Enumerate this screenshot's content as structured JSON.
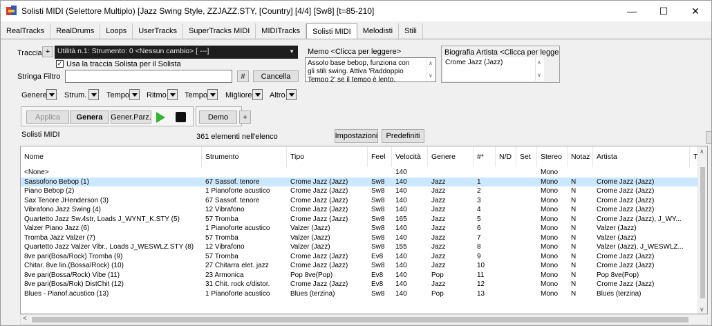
{
  "window": {
    "title": "Solisti MIDI  (Selettore Multiplo)  [Jazz Swing Style, ZZJAZZ.STY,  [Country] [4/4] [Sw8] [t=85-210]",
    "minimize": "—",
    "maximize": "☐",
    "close": "✕"
  },
  "tabs": [
    "RealTracks",
    "RealDrums",
    "Loops",
    "UserTracks",
    "SuperTracks MIDI",
    "MIDITracks",
    "Solisti MIDI",
    "Melodisti",
    "Stili"
  ],
  "active_tab": "Solisti MIDI",
  "track": {
    "label": "Traccia",
    "plus": "+",
    "value": "Utilità n.1: Strumento: 0 <Nessun cambio> [ ---]",
    "checkbox_label": "Usa la traccia Solista per il Solista",
    "checked": true
  },
  "filter": {
    "label": "Stringa Filtro",
    "value": "",
    "hash": "#",
    "cancel": "Cancella"
  },
  "memo": {
    "label": "Memo  <Clicca per leggere>",
    "text": "Assolo base bebop, funziona con gli stili swing. Attiva 'Raddoppio Tempo 2' se il tempo è lento."
  },
  "bio": {
    "label": "Biografia Artista  <Clicca per leggere>",
    "text": "Crome Jazz (Jazz)"
  },
  "filters": [
    "Genere",
    "Strum.",
    "Tempo",
    "Ritmo",
    "Tempo",
    "Migliore",
    "Altro"
  ],
  "actions": {
    "apply": "Applica",
    "generate": "Genera",
    "partial": "Gener.Parz.",
    "demo": "Demo",
    "plus": "+"
  },
  "list": {
    "title": "Solisti MIDI",
    "count": "361 elementi nell'elenco",
    "settings": "Impostazioni",
    "defaults": "Predefiniti"
  },
  "columns": [
    "Nome",
    "Strumento",
    "Tipo",
    "Feel",
    "Velocità",
    "Genere",
    "#*",
    "N/D",
    "Set",
    "Stereo",
    "Notaz",
    "Artista",
    "TS"
  ],
  "rows": [
    [
      "<None>",
      "",
      "",
      "",
      "140",
      "",
      "",
      "",
      "",
      "Mono",
      "",
      "",
      ""
    ],
    [
      "Sassofono Bebop  (1)",
      "67 Sassof. tenore",
      "Crome Jazz (Jazz)",
      "Sw8",
      "140",
      "Jazz",
      "1",
      "",
      "",
      "Mono",
      "N",
      "Crome Jazz (Jazz)",
      ""
    ],
    [
      "Piano Bebop  (2)",
      "1 Pianoforte acustico",
      "Crome Jazz (Jazz)",
      "Sw8",
      "140",
      "Jazz",
      "2",
      "",
      "",
      "Mono",
      "N",
      "Crome Jazz (Jazz)",
      ""
    ],
    [
      "Sax Tenore JHenderson  (3)",
      "67 Sassof. tenore",
      "Crome Jazz (Jazz)",
      "Sw8",
      "140",
      "Jazz",
      "3",
      "",
      "",
      "Mono",
      "N",
      "Crome Jazz (Jazz)",
      ""
    ],
    [
      "Vibrafono Jazz Swing  (4)",
      "12 Vibrafono",
      "Crome Jazz (Jazz)",
      "Sw8",
      "140",
      "Jazz",
      "4",
      "",
      "",
      "Mono",
      "N",
      "Crome Jazz (Jazz)",
      ""
    ],
    [
      "Quartetto Jazz Sw.4str, Loads J_WYNT_K.STY  (5)",
      "57 Tromba",
      "Crome Jazz (Jazz)",
      "Sw8",
      "165",
      "Jazz",
      "5",
      "",
      "",
      "Mono",
      "N",
      "Crome Jazz (Jazz), J_WY...",
      ""
    ],
    [
      "Valzer Piano Jazz  (6)",
      "1 Pianoforte acustico",
      "Valzer (Jazz)",
      "Sw8",
      "140",
      "Jazz",
      "6",
      "",
      "",
      "Mono",
      "N",
      "Valzer (Jazz)",
      ""
    ],
    [
      "Tromba Jazz Valzer  (7)",
      "57 Tromba",
      "Valzer (Jazz)",
      "Sw8",
      "140",
      "Jazz",
      "7",
      "",
      "",
      "Mono",
      "N",
      "Valzer (Jazz)",
      ""
    ],
    [
      "Quartetto Jazz Valzer Vibr., Loads J_WESWLZ.STY  (8)",
      "12 Vibrafono",
      "Valzer (Jazz)",
      "Sw8",
      "155",
      "Jazz",
      "8",
      "",
      "",
      "Mono",
      "N",
      "Valzer (Jazz), J_WESWLZ...",
      ""
    ],
    [
      "8ve pari(Bosa/Rock) Tromba  (9)",
      "57 Tromba",
      "Crome Jazz (Jazz)",
      "Ev8",
      "140",
      "Jazz",
      "9",
      "",
      "",
      "Mono",
      "N",
      "Crome Jazz (Jazz)",
      ""
    ],
    [
      "Chitar. 8ve lin.(Bossa/Rock)  (10)",
      "27 Chitarra elet. jazz",
      "Crome Jazz (Jazz)",
      "Sw8",
      "140",
      "Jazz",
      "10",
      "",
      "",
      "Mono",
      "N",
      "Crome Jazz (Jazz)",
      ""
    ],
    [
      "8ve pari(Bossa/Rock) Vibe  (11)",
      "23 Armonica",
      "Pop 8ve(Pop)",
      "Ev8",
      "140",
      "Pop",
      "11",
      "",
      "",
      "Mono",
      "N",
      "Pop 8ve(Pop)",
      ""
    ],
    [
      "8ve pari(Bosa/Rok) DistChit  (12)",
      "31 Chit. rock c/distor.",
      "Crome Jazz (Jazz)",
      "Ev8",
      "140",
      "Jazz",
      "12",
      "",
      "",
      "Mono",
      "N",
      "Crome Jazz (Jazz)",
      ""
    ],
    [
      "Blues - Pianof.acustico  (13)",
      "1 Pianoforte acustico",
      "Blues (terzina)",
      "Sw8",
      "140",
      "Pop",
      "13",
      "",
      "",
      "Mono",
      "N",
      "Blues (terzina)",
      ""
    ]
  ],
  "selected_row": 1,
  "colors": {
    "selection": "#cce8ff",
    "track_bg": "#1e1e1e",
    "play": "#2eb82e"
  }
}
